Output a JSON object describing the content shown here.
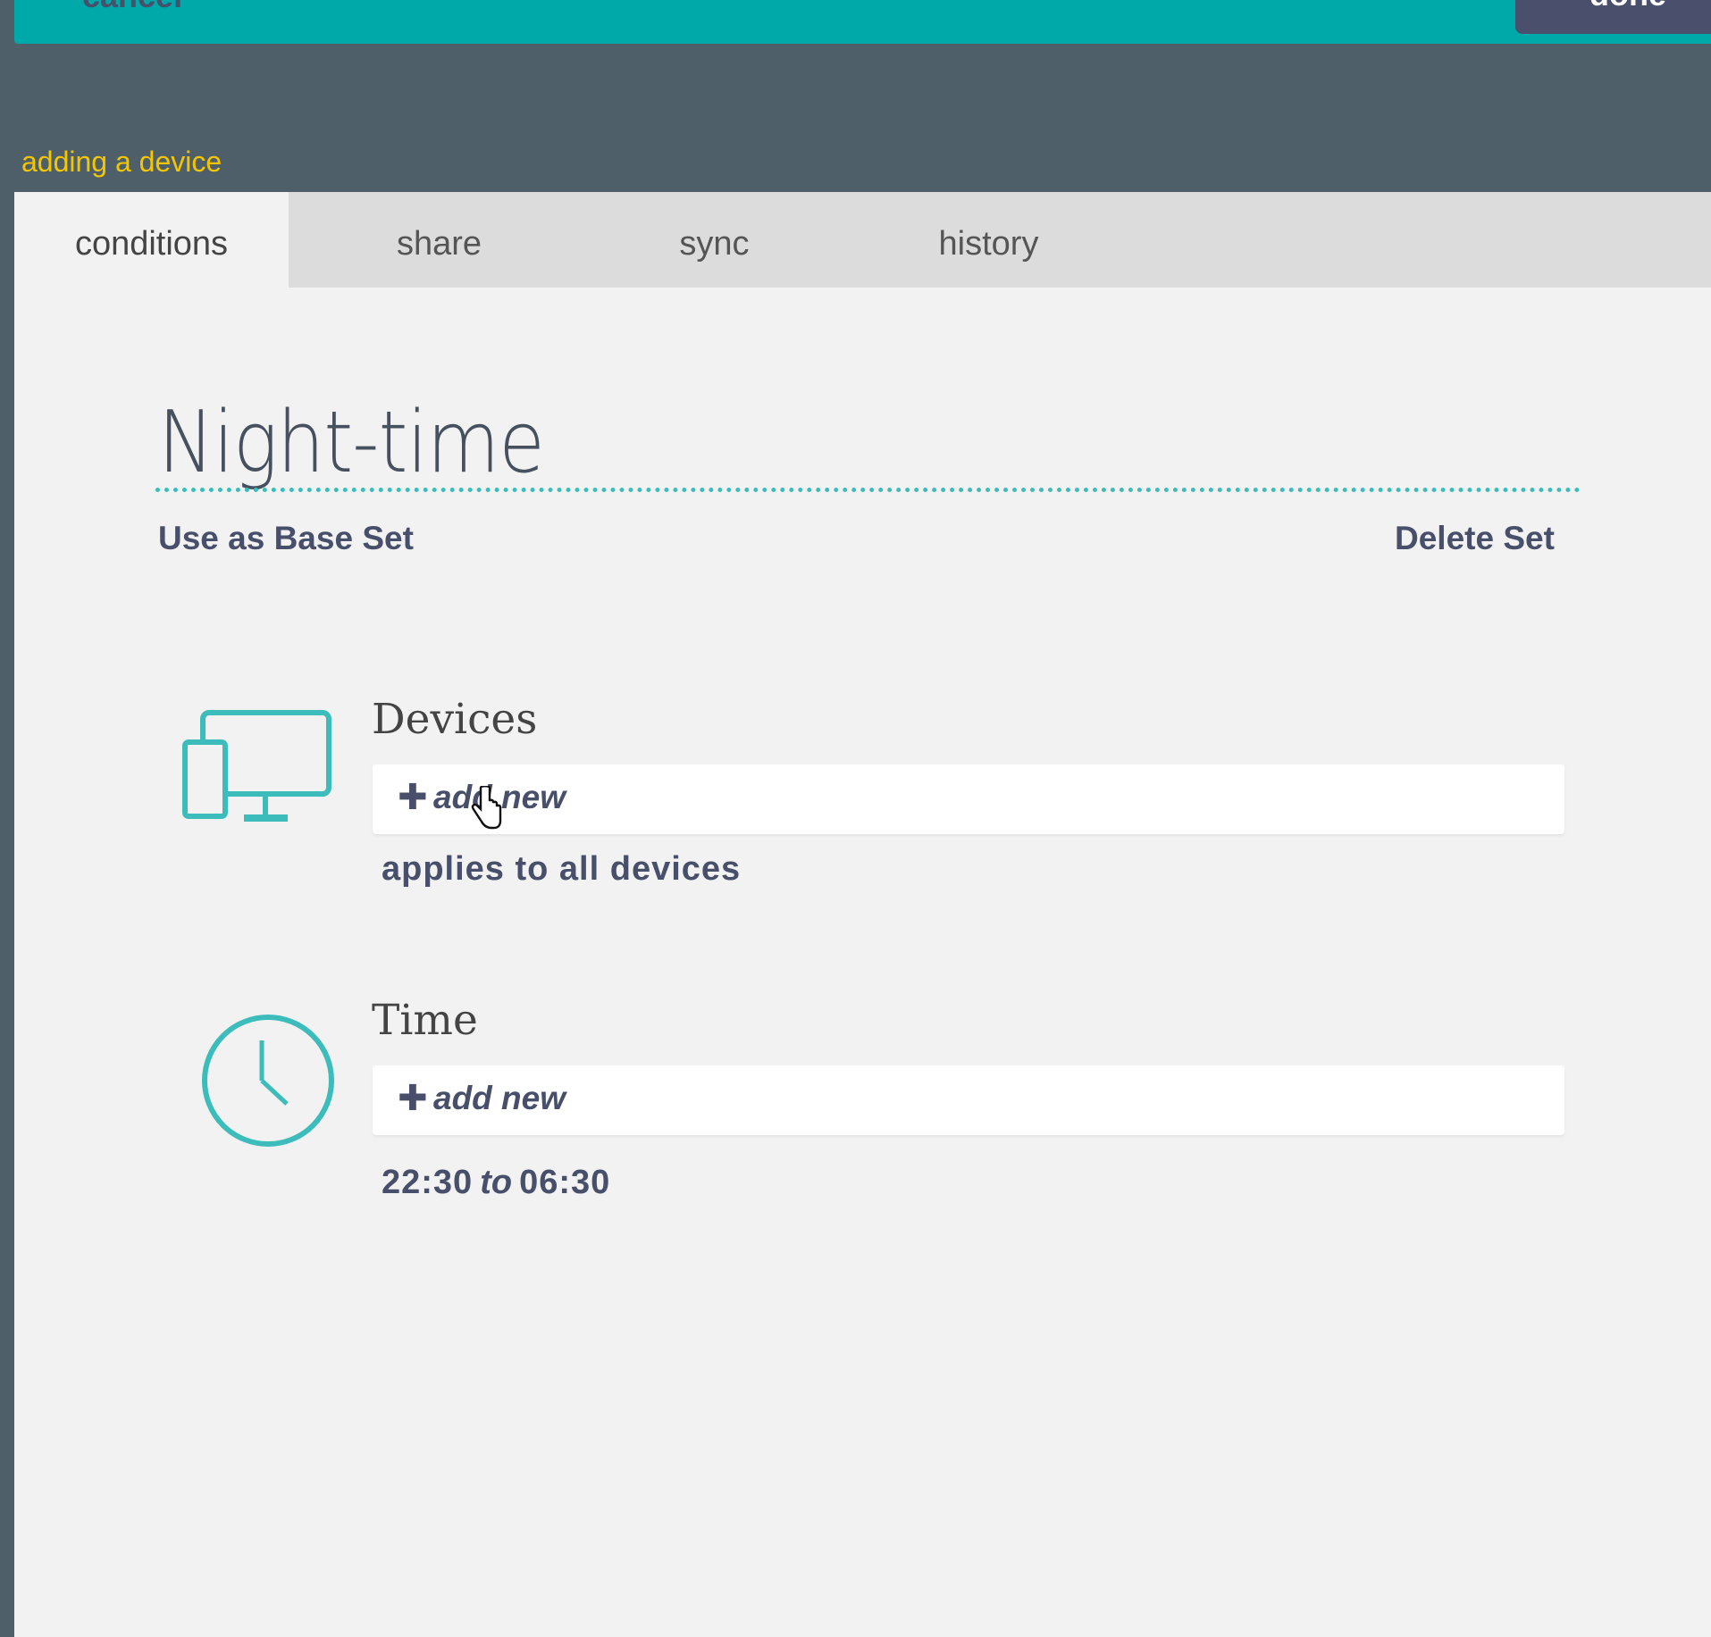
{
  "topbar": {
    "cancel_label": "cancel",
    "done_label": "done",
    "accent_color": "#00a9a9"
  },
  "status_text": "adding a device",
  "tabs": [
    {
      "label": "conditions",
      "active": true
    },
    {
      "label": "share",
      "active": false
    },
    {
      "label": "sync",
      "active": false
    },
    {
      "label": "history",
      "active": false
    }
  ],
  "set": {
    "title": "Night-time",
    "use_base_label": "Use as Base Set",
    "delete_label": "Delete Set"
  },
  "sections": {
    "devices": {
      "heading": "Devices",
      "icon": "devices-icon",
      "add_label": "add new",
      "note": "applies to all devices"
    },
    "time": {
      "heading": "Time",
      "icon": "clock-icon",
      "add_label": "add new",
      "start": "22:30",
      "separator": "to",
      "end": "06:30"
    }
  },
  "colors": {
    "header_bg": "#4f5f69",
    "panel_bg": "#f2f2f2",
    "tab_bg": "#dcdcdc",
    "teal": "#3dbcbc",
    "status_yellow": "#f3c600",
    "text_dark": "#474f6b"
  }
}
